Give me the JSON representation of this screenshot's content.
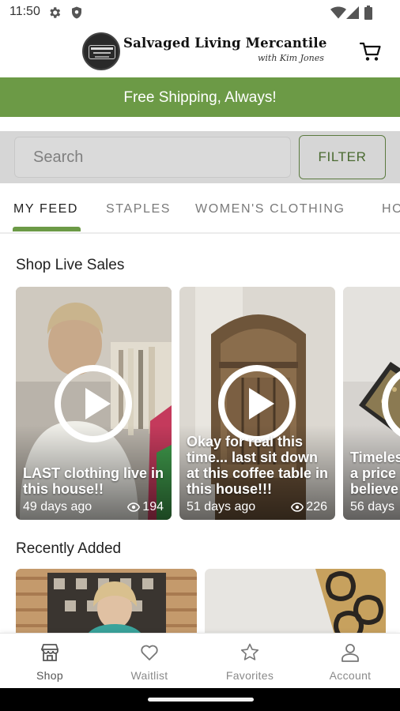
{
  "status_bar": {
    "time": "11:50",
    "icons": [
      "settings-gear-icon",
      "shield-icon",
      "wifi-icon",
      "cellular-signal-icon",
      "battery-icon"
    ]
  },
  "header": {
    "brand_title": "Salvaged Living Mercantile",
    "brand_subtitle": "with Kim Jones",
    "logo_badge_lines": [
      "Salvaged",
      "Living",
      "Mercantile"
    ],
    "cart_icon": "shopping-cart-icon"
  },
  "banner": {
    "text": "Free Shipping, Always!",
    "color": "#6c9a46"
  },
  "search": {
    "placeholder": "Search",
    "value": "",
    "filter_label": "FILTER"
  },
  "tabs": {
    "items": [
      {
        "label": "MY FEED",
        "active": true
      },
      {
        "label": "STAPLES",
        "active": false
      },
      {
        "label": "WOMEN'S CLOTHING",
        "active": false
      },
      {
        "label": "HO",
        "active": false
      }
    ]
  },
  "live_sales": {
    "title": "Shop Live Sales",
    "cards": [
      {
        "title": "LAST clothing live in this house!!",
        "age": "49 days ago",
        "views": "194"
      },
      {
        "title": "Okay for real this time... last sit down at this coffee table in this house!!!",
        "age": "51 days ago",
        "views": "226"
      },
      {
        "title": "Timeless a price believe",
        "age": "56 days",
        "views": ""
      }
    ]
  },
  "recently_added": {
    "title": "Recently Added"
  },
  "bottom_nav": {
    "items": [
      {
        "label": "Shop",
        "icon": "storefront-icon",
        "active": true
      },
      {
        "label": "Waitlist",
        "icon": "heart-icon",
        "active": false
      },
      {
        "label": "Favorites",
        "icon": "star-icon",
        "active": false
      },
      {
        "label": "Account",
        "icon": "person-icon",
        "active": false
      }
    ]
  },
  "colors": {
    "accent": "#6c9a46",
    "filter_text": "#4a6a30"
  }
}
